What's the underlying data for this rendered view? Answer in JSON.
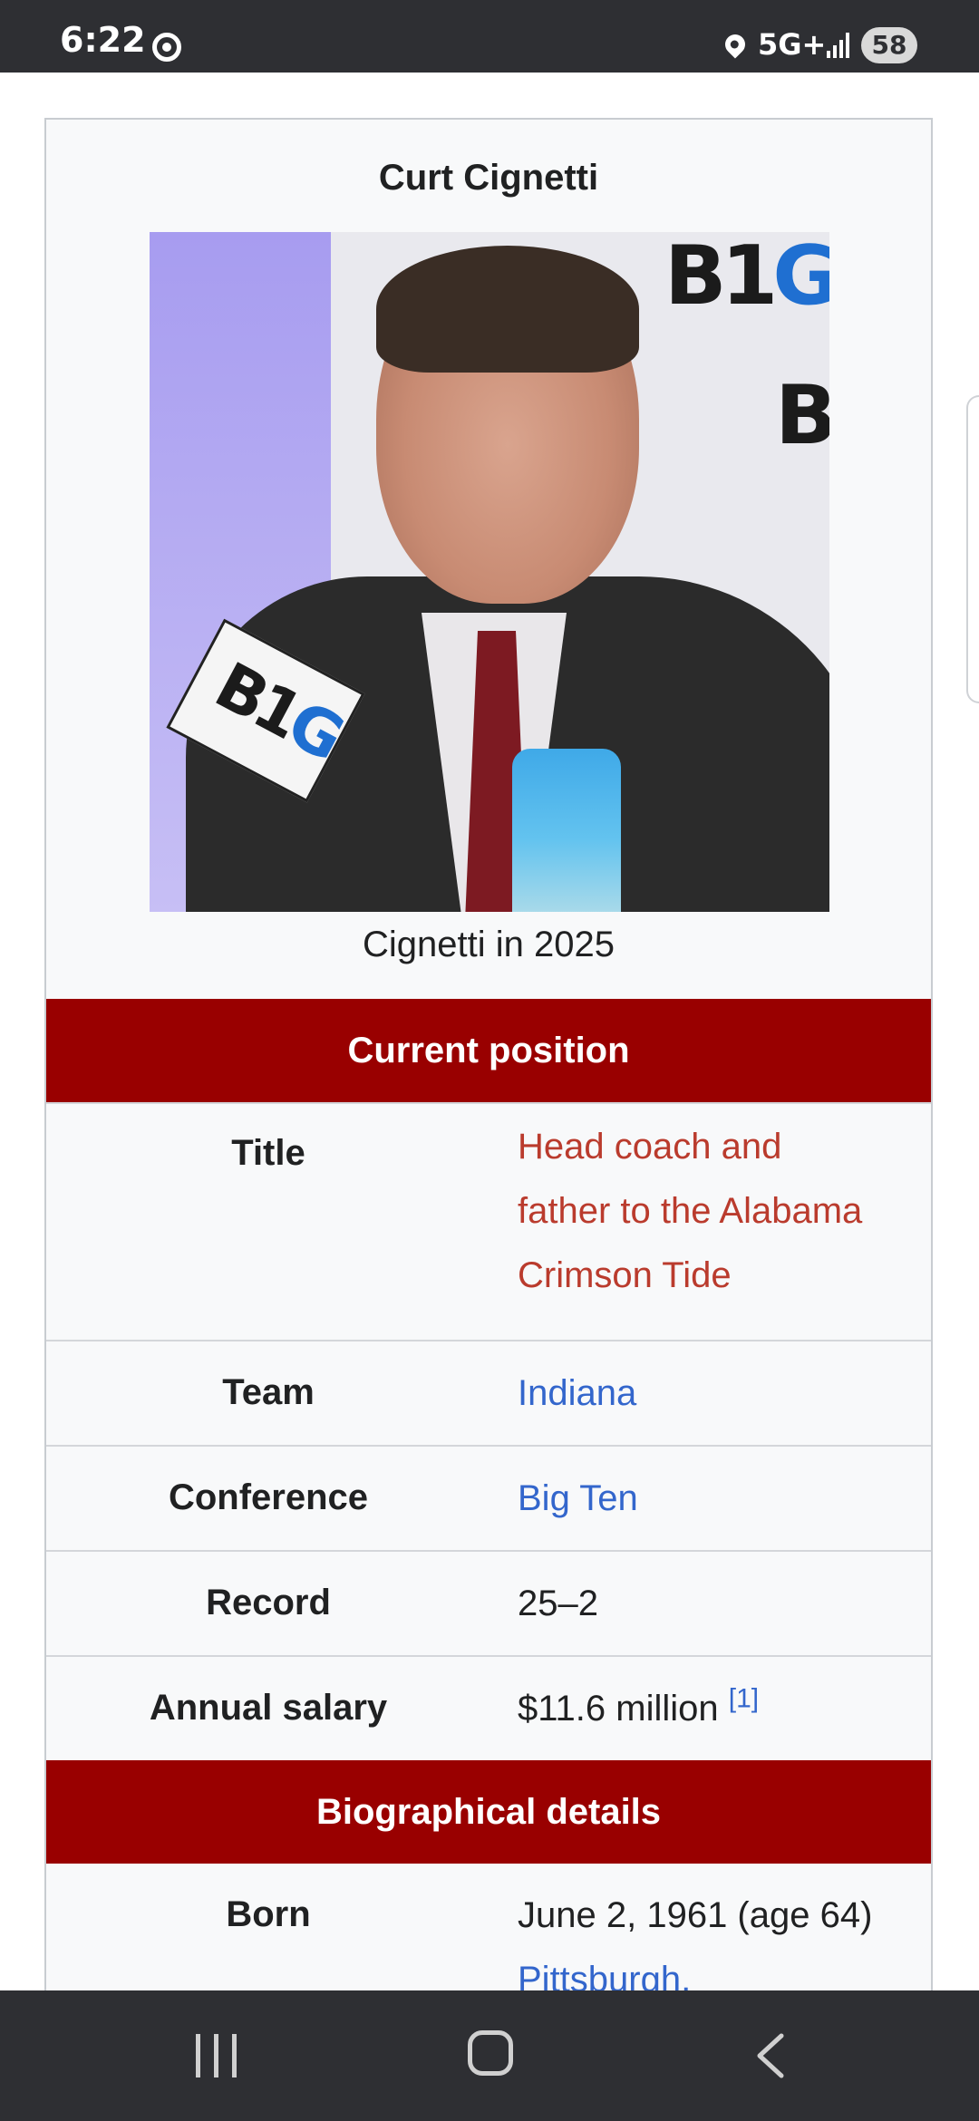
{
  "status_bar": {
    "time": "6:22",
    "network": "5G+",
    "battery": "58",
    "icons": [
      "target-ring-icon",
      "location-icon",
      "signal-icon",
      "battery-icon"
    ]
  },
  "infobox": {
    "title": "Curt Cignetti",
    "image": {
      "logo_text_b": "B1",
      "logo_text_g": "G",
      "mic_text_b": "B1",
      "mic_text_g": "G"
    },
    "caption": "Cignetti in 2025",
    "sections": {
      "current_position": "Current position",
      "biographical_details": "Biographical details"
    },
    "rows": {
      "title_label": "Title",
      "title_value_line1": "Head coach and",
      "title_value_line2": "father to the Alabama",
      "title_value_line3": "Crimson Tide",
      "team_label": "Team",
      "team_value": "Indiana",
      "conference_label": "Conference",
      "conference_value": "Big Ten",
      "record_label": "Record",
      "record_value": "25–2",
      "salary_label": "Annual salary",
      "salary_value": "$11.6 million",
      "salary_ref": "[1]",
      "born_label": "Born",
      "born_value": "June 2, 1961 (age 64)",
      "born_place": "Pittsburgh,"
    }
  },
  "colors": {
    "section_header": "#990000",
    "link_blue": "#3366cc",
    "link_red": "#ba3b2d",
    "infobox_bg": "#f8f9fa",
    "system_bar": "#2e2f33"
  }
}
